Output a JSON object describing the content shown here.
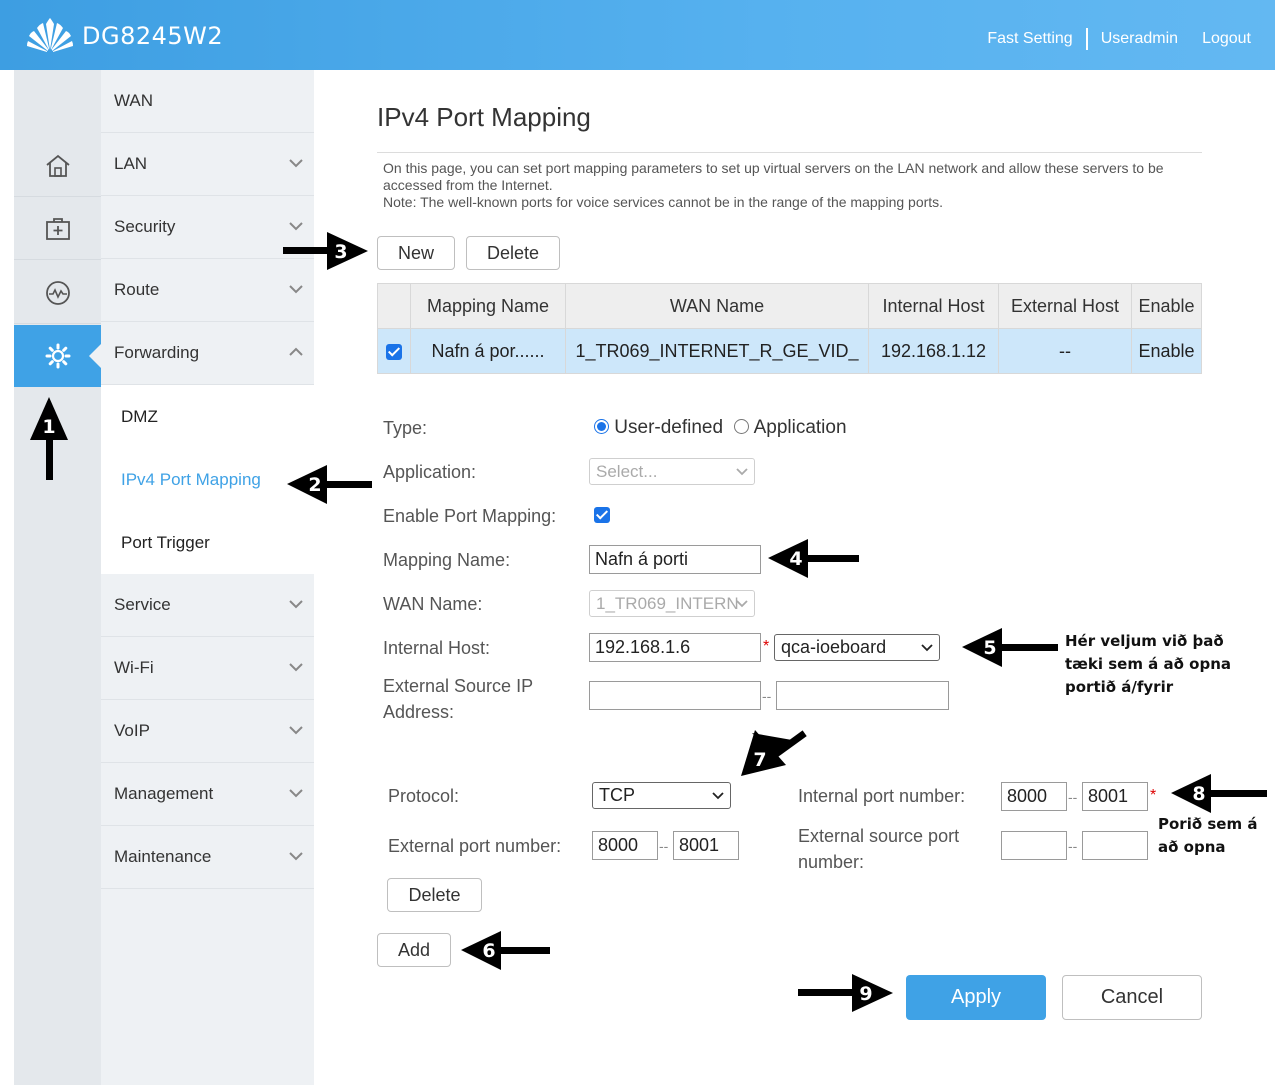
{
  "header": {
    "model": "DG8245W2",
    "links": [
      "Fast Setting",
      "Useradmin",
      "Logout"
    ]
  },
  "nav_icons": [
    "home-icon",
    "medical-kit-icon",
    "pulse-icon",
    "gear-icon"
  ],
  "sidebar": {
    "items": [
      {
        "label": "WAN"
      },
      {
        "label": "LAN"
      },
      {
        "label": "Security"
      },
      {
        "label": "Route"
      },
      {
        "label": "Forwarding"
      },
      {
        "label": "Service"
      },
      {
        "label": "Wi-Fi"
      },
      {
        "label": "VoIP"
      },
      {
        "label": "Management"
      },
      {
        "label": "Maintenance"
      }
    ],
    "sub_items": [
      {
        "label": "DMZ"
      },
      {
        "label": "IPv4 Port Mapping"
      },
      {
        "label": "Port Trigger"
      }
    ]
  },
  "page": {
    "title": "IPv4 Port Mapping",
    "description": "On this page, you can set port mapping parameters to set up virtual servers on the LAN network and allow these servers to be accessed from the Internet.",
    "note": "Note: The well-known ports for voice services cannot be in the range of the mapping ports."
  },
  "toolbar": {
    "new_label": "New",
    "delete_label": "Delete"
  },
  "table": {
    "headers": [
      "Mapping Name",
      "WAN Name",
      "Internal Host",
      "External Host",
      "Enable"
    ],
    "rows": [
      {
        "mapping_name": "Nafn á por......",
        "wan_name": "1_TR069_INTERNET_R_GE_VID_",
        "internal_host": "192.168.1.12",
        "external_host": "--",
        "enable": "Enable"
      }
    ]
  },
  "form": {
    "type_label": "Type:",
    "type_options": [
      "User-defined",
      "Application"
    ],
    "application_label": "Application:",
    "application_placeholder": "Select...",
    "enable_label": "Enable Port Mapping:",
    "mapping_name_label": "Mapping Name:",
    "mapping_name_value": "Nafn á porti",
    "wan_name_label": "WAN Name:",
    "wan_name_value": "1_TR069_INTERN",
    "internal_host_label": "Internal Host:",
    "internal_host_value": "192.168.1.6",
    "internal_host_device": "qca-ioeboard",
    "ext_source_ip_label_1": "External Source IP",
    "ext_source_ip_label_2": "Address:",
    "star": "*",
    "dashes": "--"
  },
  "protocol": {
    "protocol_label": "Protocol:",
    "protocol_value": "TCP",
    "internal_port_label": "Internal port number:",
    "internal_port_start": "8000",
    "internal_port_end": "8001",
    "external_port_label": "External port number:",
    "external_port_start": "8000",
    "external_port_end": "8001",
    "ext_source_port_label_1": "External source port",
    "ext_source_port_label_2": "number:",
    "delete_label": "Delete"
  },
  "actions": {
    "add_label": "Add",
    "apply_label": "Apply",
    "cancel_label": "Cancel"
  },
  "annotations": {
    "n1": "1",
    "n2": "2",
    "n3": "3",
    "n4": "4",
    "n5": "5",
    "n6": "6",
    "n7": "7",
    "n8": "8",
    "n9": "9",
    "note5": [
      "Hér veljum við það",
      "tæki sem á að opna",
      "portið á/fyrir"
    ],
    "note8": [
      "Porið sem á",
      "að opna"
    ]
  },
  "colors": {
    "header": "#4aa9eb",
    "accent": "#3fa2e6",
    "table_row": "#cde7fa"
  }
}
